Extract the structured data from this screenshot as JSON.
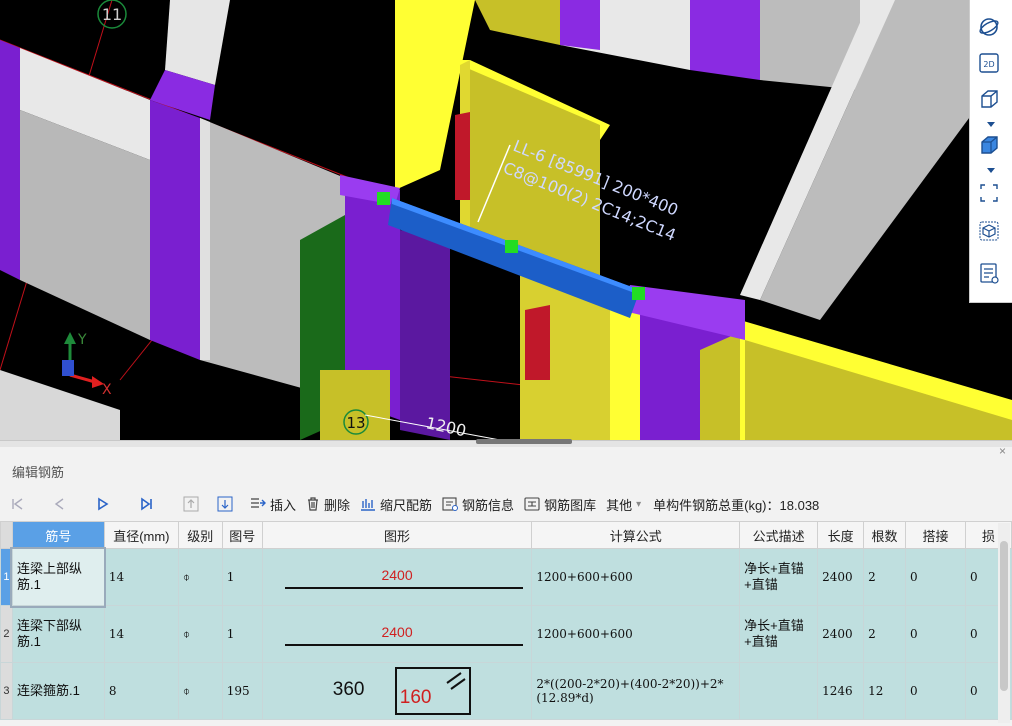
{
  "viewport": {
    "axis_num_top": "11",
    "axis_num_bottom": "13",
    "beam_label_line1": "LL-6 [85991] 200*400",
    "beam_label_line2": "C8@100(2) 2C14;2C14",
    "dim_text": "1200",
    "axis_y": "Y",
    "axis_x": "X"
  },
  "view_toolbar": {
    "icons": [
      "orbit-icon",
      "2d-view-icon",
      "3d-box-icon",
      "3d-box-solid-icon",
      "select-frame-icon",
      "component-icon",
      "list-eye-icon"
    ],
    "label_2d": "2D"
  },
  "panel": {
    "title": "编辑钢筋",
    "close": "×"
  },
  "toolbar": {
    "insert": "插入",
    "delete": "删除",
    "scale": "缩尺配筋",
    "rebar_info": "钢筋信息",
    "rebar_lib": "钢筋图库",
    "other": "其他",
    "other_arrow": "▾",
    "total_label": "单构件钢筋总重(kg)：18.038"
  },
  "table": {
    "columns": [
      "筋号",
      "直径(mm)",
      "级别",
      "图号",
      "图形",
      "计算公式",
      "公式描述",
      "长度",
      "根数",
      "搭接",
      "损"
    ],
    "rows": [
      {
        "idx": "1",
        "name": "连梁上部纵筋.1",
        "dia": "14",
        "grade": "⌽",
        "fig": "1",
        "shape_val": "2400",
        "formula": "1200+600+600",
        "desc": "净长+直锚+直锚",
        "len": "2400",
        "count": "2",
        "lap": "0",
        "loss": "0"
      },
      {
        "idx": "2",
        "name": "连梁下部纵筋.1",
        "dia": "14",
        "grade": "⌽",
        "fig": "1",
        "shape_val": "2400",
        "formula": "1200+600+600",
        "desc": "净长+直锚+直锚",
        "len": "2400",
        "count": "2",
        "lap": "0",
        "loss": "0"
      },
      {
        "idx": "3",
        "name": "连梁箍筋.1",
        "dia": "8",
        "grade": "⌽",
        "fig": "195",
        "shape_w": "360",
        "shape_h": "160",
        "formula": "2*((200-2*20)+(400-2*20))+2*(12.89*d)",
        "desc": "",
        "len": "1246",
        "count": "12",
        "lap": "0",
        "loss": "0"
      }
    ]
  }
}
